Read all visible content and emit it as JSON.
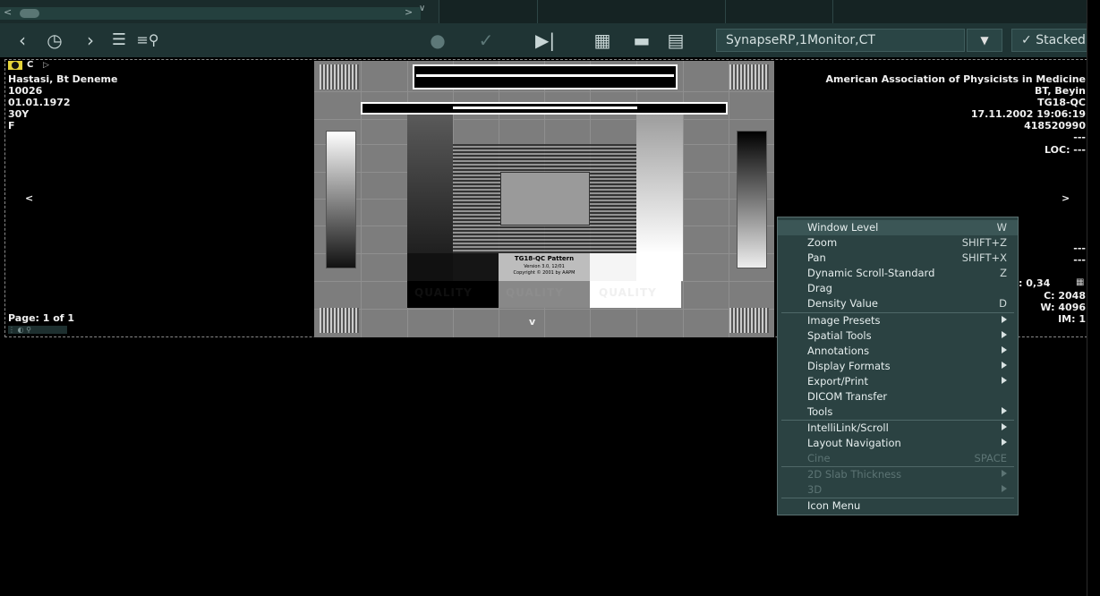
{
  "toolbar": {
    "layout_select_value": "SynapseRP,1Monitor,CT",
    "stacked_label": "Stacked",
    "icons": [
      "back-arrow-icon",
      "history-icon",
      "forward-arrow-icon",
      "list-icon",
      "search-list-icon",
      "microphone-icon",
      "checkmark-icon",
      "skip-next-icon",
      "layout-grid-icon",
      "folder-icon",
      "document-icon",
      "chevron-down-icon"
    ]
  },
  "overlay": {
    "top_marker": "C",
    "patient_name": "Hastasi, Bt Deneme",
    "patient_id": "10026",
    "birth_date": "01.01.1972",
    "age": "30Y",
    "sex": "F",
    "institution": "American Association of Physicists in Medicine",
    "study_desc": "BT, Beyin",
    "series_desc": "TG18-QC",
    "study_datetime": "17.11.2002 19:06:19",
    "accession": "418520990",
    "dash1": "---",
    "loc": "LOC: ---",
    "dash2": "---",
    "dash3": "---",
    "zoom": ": 0,34",
    "center": "C: 2048",
    "width": "W: 4096",
    "image_num": "IM: 1",
    "page": "Page: 1 of 1",
    "left_arrow": "<",
    "right_arrow": ">",
    "down_arrow": "v"
  },
  "phantom": {
    "title": "TG18-QC Pattern",
    "version": "Version 3.0, 12/01",
    "copyright": "Copyright © 2001 by AAPM",
    "quality": "QUALITY"
  },
  "context_menu": {
    "items": [
      {
        "label": "Window Level",
        "shortcut": "W"
      },
      {
        "label": "Zoom",
        "shortcut": "SHIFT+Z"
      },
      {
        "label": "Pan",
        "shortcut": "SHIFT+X"
      },
      {
        "label": "Dynamic Scroll-Standard",
        "shortcut": "Z"
      },
      {
        "label": "Drag",
        "shortcut": ""
      },
      {
        "label": "Density Value",
        "shortcut": "D"
      },
      {
        "label": "Image Presets",
        "submenu": true
      },
      {
        "label": "Spatial Tools",
        "submenu": true
      },
      {
        "label": "Annotations",
        "submenu": true
      },
      {
        "label": "Display Formats",
        "submenu": true
      },
      {
        "label": "Export/Print",
        "submenu": true
      },
      {
        "label": "DICOM Transfer"
      },
      {
        "label": "Tools",
        "submenu": true
      },
      {
        "label": "IntelliLink/Scroll",
        "submenu": true
      },
      {
        "label": "Layout Navigation",
        "submenu": true
      },
      {
        "label": "Cine",
        "shortcut": "SPACE",
        "disabled": true
      },
      {
        "label": "2D Slab Thickness",
        "submenu": true,
        "disabled": true
      },
      {
        "label": "3D",
        "submenu": true,
        "disabled": true
      },
      {
        "label": "Icon Menu"
      }
    ]
  }
}
